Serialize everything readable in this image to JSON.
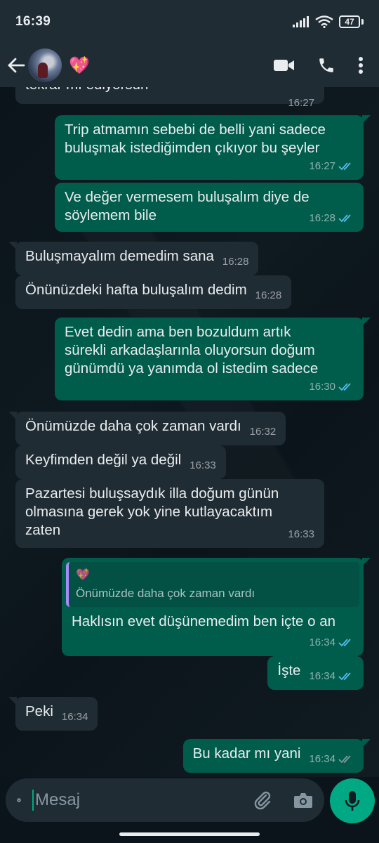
{
  "status_bar": {
    "time": "16:39",
    "battery": "47"
  },
  "header": {
    "contact_name": "💖"
  },
  "messages": [
    {
      "dir": "in",
      "text": "tekrar mı ediyorsun",
      "time": "16:27"
    },
    {
      "dir": "out",
      "text": "Trip atmamın sebebi de belli yani sadece\nbuluşmak istediğimden çıkıyor bu şeyler",
      "time": "16:27"
    },
    {
      "dir": "out",
      "text": "Ve değer vermesem buluşalım diye de\nsöylemem bile",
      "time": "16:28"
    },
    {
      "dir": "in",
      "text": "Buluşmayalım demedim sana",
      "time": "16:28"
    },
    {
      "dir": "in",
      "text": "Önünüzdeki hafta buluşalım dedim",
      "time": "16:28"
    },
    {
      "dir": "out",
      "text": "Evet dedin ama ben bozuldum artık\nsürekli arkadaşlarınla oluyorsun doğum\ngünümdü ya yanımda ol istedim sadece",
      "time": "16:30"
    },
    {
      "dir": "in",
      "text": "Önümüzde daha çok zaman vardı",
      "time": "16:32"
    },
    {
      "dir": "in",
      "text": "Keyfimden değil ya değil",
      "time": "16:33"
    },
    {
      "dir": "in",
      "text": "Pazartesi buluşsaydık illa doğum günün\nolmasına gerek yok yine kutlayacaktım\nzaten",
      "time": "16:33"
    },
    {
      "dir": "out",
      "quote_author": "💖",
      "quote_text": "Önümüzde daha çok zaman vardı",
      "text": "Haklısın evet düşünemedim ben içte o an",
      "time": "16:34"
    },
    {
      "dir": "out",
      "text": "İşte",
      "time": "16:34"
    },
    {
      "dir": "in",
      "text": "Peki",
      "time": "16:34"
    },
    {
      "dir": "out",
      "text": "Bu kadar mı yani",
      "time": "16:34"
    }
  ],
  "composer": {
    "placeholder": "Mesaj"
  },
  "colors": {
    "incoming": "#202c33",
    "outgoing": "#005c4b",
    "accent": "#00a884",
    "read_ticks": "#53bdeb"
  },
  "icons": [
    "back-arrow-icon",
    "video-call-icon",
    "phone-icon",
    "more-vert-icon",
    "emoji-icon",
    "attach-icon",
    "camera-icon",
    "mic-icon"
  ]
}
